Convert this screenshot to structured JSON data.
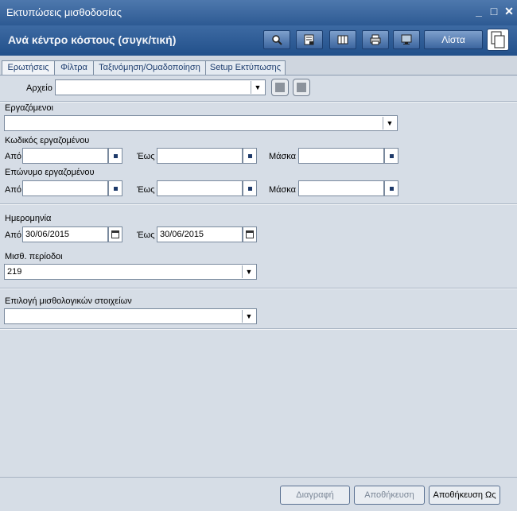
{
  "window": {
    "title": "Εκτυπώσεις μισθοδοσίας",
    "controls": [
      "_",
      "□",
      "✕"
    ]
  },
  "header": {
    "subtitle": "Ανά κέντρο κόστους (συγκ/τική)",
    "list_label": "Λίστα",
    "toolbar_icons": [
      "search-icon",
      "report-icon",
      "columns-icon",
      "print-icon",
      "monitor-icon",
      "copy-icon"
    ]
  },
  "tabs": [
    {
      "label": "Ερωτήσεις"
    },
    {
      "label": "Φίλτρα"
    },
    {
      "label": "Ταξινόμηση/Ομαδοποίηση"
    },
    {
      "label": "Setup Εκτύπωσης"
    }
  ],
  "archive": {
    "label": "Αρχείο",
    "value": ""
  },
  "employees": {
    "label": "Εργαζόμενοι",
    "value": ""
  },
  "employee_code": {
    "label": "Κωδικός εργαζομένου",
    "from_label": "Από",
    "from_value": "",
    "to_label": "Έως",
    "to_value": "",
    "mask_label": "Μάσκα",
    "mask_value": ""
  },
  "employee_surname": {
    "label": "Επώνυμο εργαζομένου",
    "from_label": "Από",
    "from_value": "",
    "to_label": "Έως",
    "to_value": "",
    "mask_label": "Μάσκα",
    "mask_value": ""
  },
  "date": {
    "label": "Ημερομηνία",
    "from_label": "Από",
    "from_value": "30/06/2015",
    "to_label": "Έως",
    "to_value": "30/06/2015"
  },
  "payroll_periods": {
    "label": "Μισθ. περίοδοι",
    "value": "219"
  },
  "payroll_items": {
    "label": "Επιλογή μισθολογικών στοιχείων",
    "value": ""
  },
  "footer": {
    "delete_label": "Διαγραφή",
    "save_label": "Αποθήκευση",
    "save_as_label": "Αποθήκευση Ως"
  }
}
